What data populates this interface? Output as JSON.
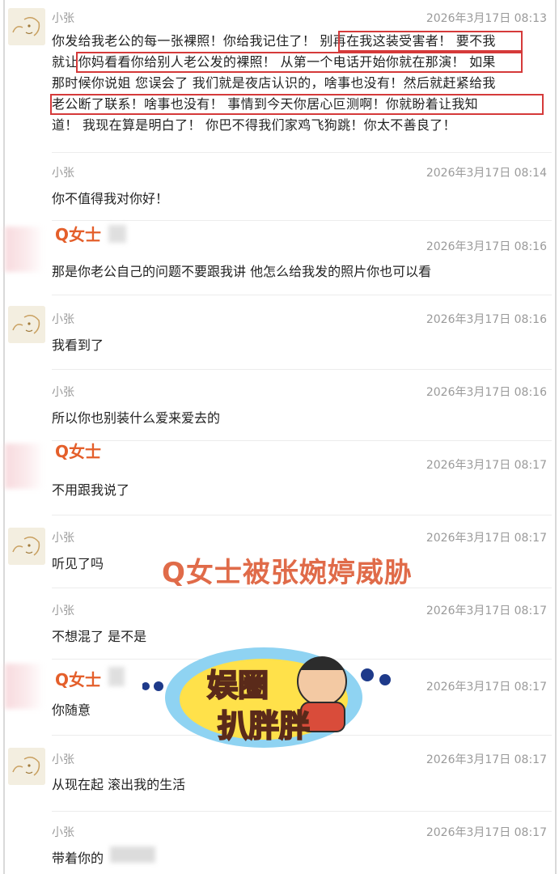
{
  "messages": [
    {
      "sender": "小张",
      "time": "2026年3月17日 08:13",
      "lines": [
        "你发给我老公的每一张裸照！你给我记住了！ 别再在我这装受害者！ 要不我",
        "就让你妈看看你给别人老公发的裸照！ 从第一个电话开始你就在那演！ 如果",
        "那时候你说姐 您误会了 我们就是夜店认识的，啥事也没有！然后就赶紧给我",
        "老公断了联系！啥事也没有！ 事情到今天你居心叵测啊！你就盼着让我知",
        "道！ 我现在算是明白了！ 你巴不得我们家鸡飞狗跳！你太不善良了！"
      ]
    },
    {
      "sender": "小张",
      "time": "2026年3月17日 08:14",
      "text": "你不值得我对你好！"
    },
    {
      "sender": "Q女士",
      "time": "2026年3月17日 08:16",
      "text": "那是你老公自己的问题不要跟我讲 他怎么给我发的照片你也可以看"
    },
    {
      "sender": "小张",
      "time": "2026年3月17日 08:16",
      "text": "我看到了"
    },
    {
      "sender": "小张",
      "time": "2026年3月17日 08:16",
      "text": "所以你也别装什么爱来爱去的"
    },
    {
      "sender": "Q女士",
      "time": "2026年3月17日 08:17",
      "text": "不用跟我说了"
    },
    {
      "sender": "小张",
      "time": "2026年3月17日 08:17",
      "text": "听见了吗"
    },
    {
      "sender": "小张",
      "time": "2026年3月17日 08:17",
      "text": "不想混了 是不是"
    },
    {
      "sender": "Q女士",
      "time": "2026年3月17日 08:17",
      "text": "你随意"
    },
    {
      "sender": "小张",
      "time": "2026年3月17日 08:17",
      "text": "从现在起 滚出我的生活"
    },
    {
      "sender": "小张",
      "time": "2026年3月17日 08:17",
      "text": "带着你的"
    }
  ],
  "overlay": {
    "caption": "Q女士被张婉婷威胁",
    "logo_line1": "娱圈",
    "logo_line2": "扒胖胖"
  },
  "colors": {
    "highlight": "#d53a3a",
    "q_name": "#e45f2b",
    "caption": "#e06b49"
  }
}
